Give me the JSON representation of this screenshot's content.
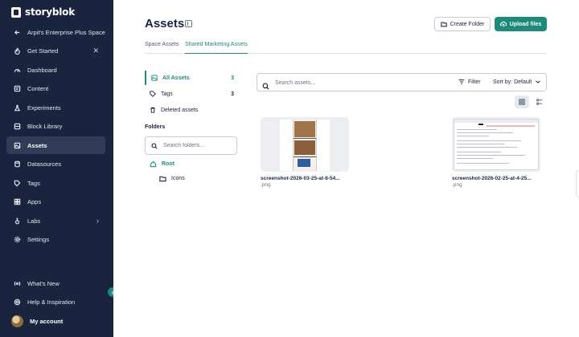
{
  "sidebar": {
    "brand": "storyblok",
    "space": "Arpit's Enterprise Plus Space",
    "get_started": "Get Started",
    "items": [
      {
        "label": "Dashboard",
        "icon": "gauge-icon"
      },
      {
        "label": "Content",
        "icon": "content-icon"
      },
      {
        "label": "Experiments",
        "icon": "flask-icon"
      },
      {
        "label": "Block Library",
        "icon": "blocks-icon"
      },
      {
        "label": "Assets",
        "icon": "image-icon"
      },
      {
        "label": "Datasources",
        "icon": "database-icon"
      },
      {
        "label": "Tags",
        "icon": "tag-icon"
      },
      {
        "label": "Apps",
        "icon": "apps-icon"
      },
      {
        "label": "Labs",
        "icon": "labs-icon"
      },
      {
        "label": "Settings",
        "icon": "gear-icon"
      }
    ],
    "bottom": {
      "whats_new": "What's New",
      "help": "Help & Inspiration",
      "account": "My account"
    }
  },
  "header": {
    "title": "Assets",
    "create_folder": "Create Folder",
    "upload_files": "Upload files"
  },
  "tabs": [
    {
      "label": "Space Assets",
      "active": false
    },
    {
      "label": "Shared Marketing Assets",
      "active": true
    }
  ],
  "filters": {
    "all_assets": {
      "label": "All Assets",
      "count": "3"
    },
    "tags": {
      "label": "Tags",
      "count": "3"
    },
    "deleted": {
      "label": "Deleted assets"
    }
  },
  "folders": {
    "label": "Folders",
    "search_placeholder": "Search folders...",
    "root": "Root",
    "children": [
      "Icons"
    ]
  },
  "assets_toolbar": {
    "search_placeholder": "Search assets...",
    "filter_label": "Filter",
    "sort_label": "Sort by: Default"
  },
  "assets": [
    {
      "name": "screenshot-2026-03-25-at-8-54...",
      "ext": ".png"
    },
    {
      "name": "screenshot-2026-02-25-at-4-25...",
      "ext": ".png"
    }
  ],
  "colors": {
    "sidebar_bg": "#1b243f",
    "accent": "#1e8a7c",
    "text": "#1b243f"
  }
}
